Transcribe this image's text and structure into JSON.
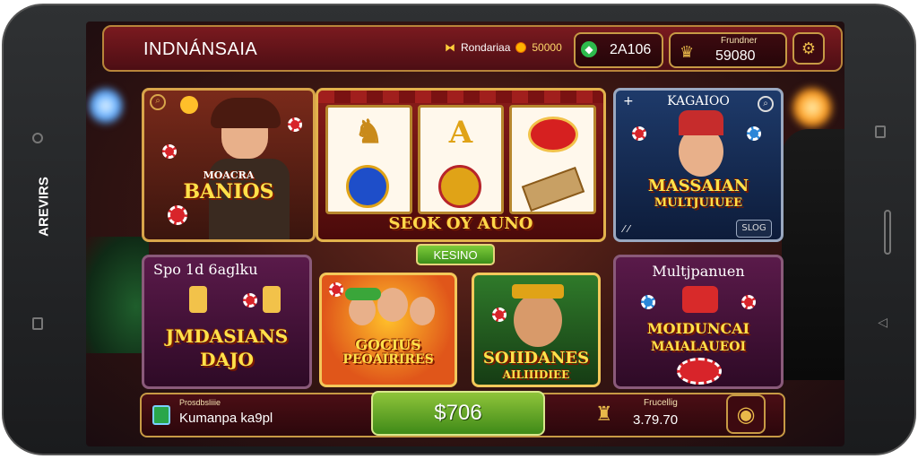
{
  "device": {
    "side_label": "AREVIRS"
  },
  "header": {
    "title": "INDNÁNSAIA",
    "promo_label": "Rondariaa",
    "promo_value": "50000",
    "balance_value": "2A106",
    "right_label": "Frundner",
    "right_value": "59080"
  },
  "tiles": {
    "top_left": {
      "title": "BANIOS",
      "subtitle": "MOACRA"
    },
    "slot_machine": {
      "caption": "SEOK OY AUNO"
    },
    "top_right": {
      "header": "KAGAIOO",
      "title": "MASSAIAN",
      "subtitle": "MULTJUIUEE",
      "button": "SLOG"
    },
    "center_badge": "KESINO",
    "bottom_left": {
      "header": "Spo 1d 6aglku",
      "title": "JMDASIANS",
      "subtitle": "DAJO"
    },
    "bottom_center_left": {
      "title": "GOCIUS",
      "subtitle": "PEOAIRIRES"
    },
    "bottom_center_right": {
      "title": "SOIIDANES",
      "subtitle": "AILIIIDIEE"
    },
    "bottom_right": {
      "header": "Multjpanuen",
      "title": "MOIDUNCAI",
      "subtitle": "MAIALAUEOI"
    }
  },
  "footer": {
    "left_label": "Prosdbsliiie",
    "left_text": "Kumanpa ka9pl",
    "spin_value": "$706",
    "right_label": "Frucellig",
    "right_value": "3.79.70"
  },
  "colors": {
    "accent": "#c79a45",
    "primary_red": "#7a1a1f",
    "spin_green": "#5ea62a",
    "gold": "#ffe14a"
  }
}
